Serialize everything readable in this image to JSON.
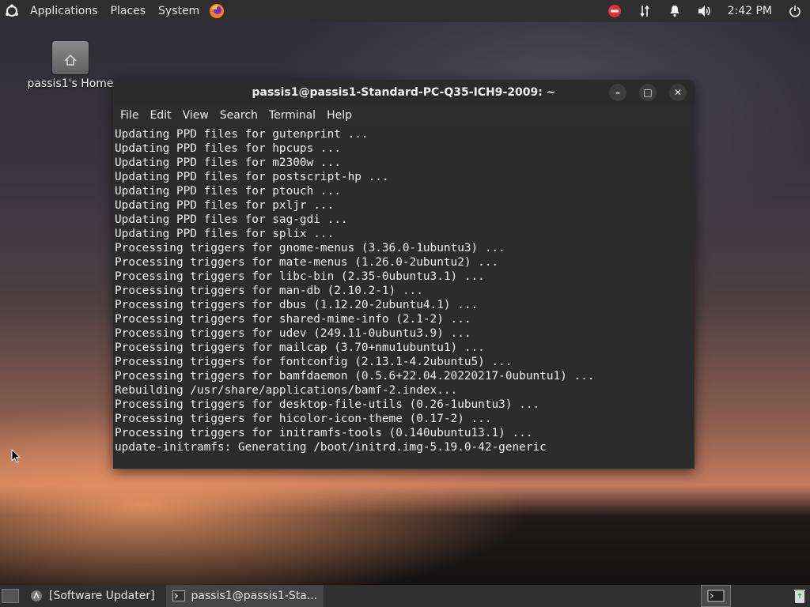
{
  "top_panel": {
    "menus": [
      "Applications",
      "Places",
      "System"
    ],
    "clock": "2:42 PM"
  },
  "desktop": {
    "home_label": "passis1's Home"
  },
  "window": {
    "title": "passis1@passis1-Standard-PC-Q35-ICH9-2009: ~",
    "minimize": "–",
    "maximize": "□",
    "close": "✕",
    "menus": [
      "File",
      "Edit",
      "View",
      "Search",
      "Terminal",
      "Help"
    ]
  },
  "terminal": {
    "lines": [
      "Updating PPD files for gutenprint ...",
      "Updating PPD files for hpcups ...",
      "Updating PPD files for m2300w ...",
      "Updating PPD files for postscript-hp ...",
      "Updating PPD files for ptouch ...",
      "Updating PPD files for pxljr ...",
      "Updating PPD files for sag-gdi ...",
      "Updating PPD files for splix ...",
      "Processing triggers for gnome-menus (3.36.0-1ubuntu3) ...",
      "Processing triggers for mate-menus (1.26.0-2ubuntu2) ...",
      "Processing triggers for libc-bin (2.35-0ubuntu3.1) ...",
      "Processing triggers for man-db (2.10.2-1) ...",
      "Processing triggers for dbus (1.12.20-2ubuntu4.1) ...",
      "Processing triggers for shared-mime-info (2.1-2) ...",
      "Processing triggers for udev (249.11-0ubuntu3.9) ...",
      "Processing triggers for mailcap (3.70+nmu1ubuntu1) ...",
      "Processing triggers for fontconfig (2.13.1-4.2ubuntu5) ...",
      "Processing triggers for bamfdaemon (0.5.6+22.04.20220217-0ubuntu1) ...",
      "Rebuilding /usr/share/applications/bamf-2.index...",
      "Processing triggers for desktop-file-utils (0.26-1ubuntu3) ...",
      "Processing triggers for hicolor-icon-theme (0.17-2) ...",
      "Processing triggers for initramfs-tools (0.140ubuntu13.1) ...",
      "update-initramfs: Generating /boot/initrd.img-5.19.0-42-generic"
    ]
  },
  "taskbar": {
    "tasks": [
      "[Software Updater]",
      "passis1@passis1-Sta..."
    ]
  },
  "colors": {
    "panel": "#2f2f2f",
    "terminal_bg": "#2c2c2c",
    "dnd_red": "#e0303a",
    "firefox_orange": "#ff7a1a"
  },
  "icons": {
    "launcher": "ubuntu-mate-logo-icon",
    "browser": "firefox-icon",
    "status": [
      "do-not-disturb-icon",
      "network-icon",
      "notification-bell-icon",
      "volume-icon",
      "power-icon"
    ]
  }
}
